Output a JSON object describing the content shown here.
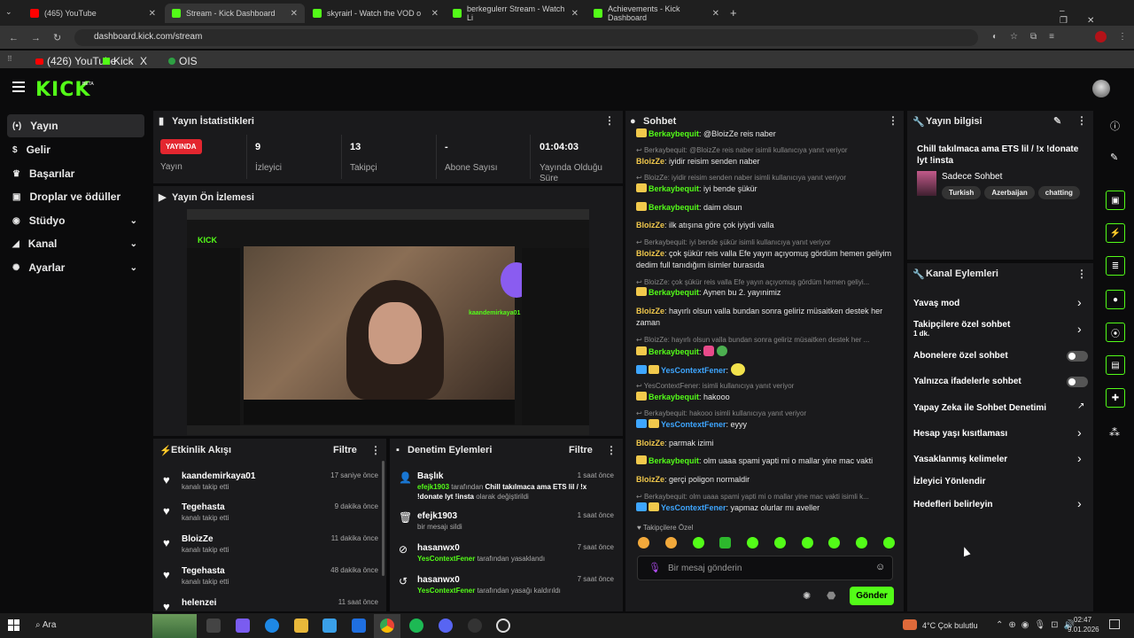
{
  "browser": {
    "tabs": [
      {
        "label": "(465) YouTube",
        "color": "#ff0000"
      },
      {
        "label": "Stream - Kick Dashboard",
        "color": "#53fc18"
      },
      {
        "label": "skyrairl - Watch the VOD o",
        "color": "#53fc18"
      },
      {
        "label": "berkegulerr Stream - Watch Li",
        "color": "#53fc18"
      },
      {
        "label": "Achievements - Kick Dashboard",
        "color": "#53fc18"
      }
    ],
    "url": "dashboard.kick.com/stream",
    "bookmarks": [
      "(426) YouTube",
      "Kick",
      "X",
      "OIS"
    ]
  },
  "brand": {
    "logo": "KICK",
    "beta": "BETA"
  },
  "sidebar": {
    "items": [
      {
        "label": "Yayın",
        "icon": "broadcast-icon"
      },
      {
        "label": "Gelir",
        "icon": "money-icon"
      },
      {
        "label": "Başarılar",
        "icon": "trophy-icon"
      },
      {
        "label": "Droplar ve ödüller",
        "icon": "gift-icon"
      },
      {
        "label": "Stüdyo",
        "icon": "studio-icon"
      },
      {
        "label": "Kanal",
        "icon": "channel-icon"
      },
      {
        "label": "Ayarlar",
        "icon": "gear-icon"
      }
    ]
  },
  "stats": {
    "title": "Yayın İstatistikleri",
    "live_badge": "YAYINDA",
    "items": [
      {
        "value": "",
        "label": "Yayın"
      },
      {
        "value": "9",
        "label": "İzleyici"
      },
      {
        "value": "13",
        "label": "Takipçi"
      },
      {
        "value": "-",
        "label": "Abone Sayısı"
      },
      {
        "value": "01:04:03",
        "label": "Yayında Olduğu Süre"
      }
    ]
  },
  "preview": {
    "title": "Yayın Ön İzlemesi",
    "overlay_text": "kaandemirkaya01 is now following!"
  },
  "activity": {
    "title": "Etkinlik Akışı",
    "filter": "Filtre",
    "items": [
      {
        "name": "kaandemirkaya01",
        "sub": "kanalı takip etti",
        "time": "17 saniye önce"
      },
      {
        "name": "Tegehasta",
        "sub": "kanalı takip etti",
        "time": "9 dakika önce"
      },
      {
        "name": "BloizZe",
        "sub": "kanalı takip etti",
        "time": "11 dakika önce"
      },
      {
        "name": "Tegehasta",
        "sub": "kanalı takip etti",
        "time": "48 dakika önce"
      },
      {
        "name": "helenzei",
        "sub": "",
        "time": "11 saat önce"
      }
    ]
  },
  "moderation": {
    "title": "Denetim Eylemleri",
    "filter": "Filtre",
    "items": [
      {
        "name": "Başlık",
        "actor": "efejk1903",
        "sub": " tarafından ",
        "detail": "Chill takılmaca ama ETS lil / !x !donate lyt !insta",
        "suffix": " olarak değiştirildi",
        "time": "1 saat önce",
        "icon": "edit-user-icon"
      },
      {
        "name": "efejk1903",
        "actor": "",
        "sub": "bir mesajı sildi",
        "detail": "",
        "suffix": "",
        "time": "1 saat önce",
        "icon": "trash-icon"
      },
      {
        "name": "hasanwx0",
        "actor": "YesContextFener",
        "sub": " tarafından yasaklandı",
        "detail": "",
        "suffix": "",
        "time": "7 saat önce",
        "icon": "ban-icon"
      },
      {
        "name": "hasanwx0",
        "actor": "YesContextFener",
        "sub": " tarafından yasağı kaldırıldı",
        "detail": "",
        "suffix": "",
        "time": "7 saat önce",
        "icon": "undo-icon"
      }
    ]
  },
  "chat": {
    "title": "Sohbet",
    "top_partial": {
      "user": "Berkaybequit",
      "text": "@BloizZe reis naber"
    },
    "messages": [
      {
        "reply": "Berkaybequit: @BloizZe reis naber isimli kullanıcıya yanıt veriyor",
        "user": "BloizZe",
        "ucolor": "ye",
        "text": "iyidir reisim senden naber",
        "badge": ""
      },
      {
        "reply": "BloizZe: iyidir reisim senden naber isimli kullanıcıya yanıt veriyor",
        "user": "Berkaybequit",
        "ucolor": "gr",
        "text": "iyi bende şükür",
        "badge": "crown"
      },
      {
        "reply": "",
        "user": "Berkaybequit",
        "ucolor": "gr",
        "text": "daim olsun",
        "badge": "crown"
      },
      {
        "reply": "",
        "user": "BloizZe",
        "ucolor": "ye",
        "text": "ilk atışına göre çok iyiydi valla",
        "badge": ""
      },
      {
        "reply": "Berkaybequit: iyi bende şükür isimli kullanıcıya yanıt veriyor",
        "user": "BloizZe",
        "ucolor": "ye",
        "text": "çok şükür reis valla Efe yayın açıyomuş gördüm hemen geliyim dedim full tanıdığım isimler burasıda",
        "badge": ""
      },
      {
        "reply": "BloizZe: çok şükür reis valla Efe yayın açıyomuş gördüm hemen geliyi...",
        "user": "Berkaybequit",
        "ucolor": "gr",
        "text": "Aynen bu 2. yayınimiz",
        "badge": "crown"
      },
      {
        "reply": "",
        "user": "BloizZe",
        "ucolor": "ye",
        "text": "hayırlı olsun valla bundan sonra geliriz müsaitken destek her zaman",
        "badge": ""
      },
      {
        "reply": "BloizZe: hayırlı olsun valla bundan sonra geliriz müsaitken destek her ...",
        "user": "Berkaybequit",
        "ucolor": "gr",
        "text": "",
        "badge": "crown"
      },
      {
        "reply": "",
        "user": "YesContextFener",
        "ucolor": "bl",
        "text": "",
        "badge": "both"
      },
      {
        "reply": "YesContextFener: isimli kullanıcıya yanıt veriyor",
        "user": "Berkaybequit",
        "ucolor": "gr",
        "text": "hakooo",
        "badge": "crown"
      },
      {
        "reply": "Berkaybequit: hakooo isimli kullanıcıya yanıt veriyor",
        "user": "YesContextFener",
        "ucolor": "bl",
        "text": "eyyy",
        "badge": "both"
      },
      {
        "reply": "",
        "user": "BloizZe",
        "ucolor": "ye",
        "text": "parmak izimi",
        "badge": ""
      },
      {
        "reply": "",
        "user": "Berkaybequit",
        "ucolor": "gr",
        "text": "olm uaaa spami yapti mi o mallar yine mac vakti",
        "badge": "crown"
      },
      {
        "reply": "",
        "user": "BloizZe",
        "ucolor": "ye",
        "text": "gerçi poligon normaldir",
        "badge": ""
      },
      {
        "reply": "Berkaybequit: olm uaaa spami yapti mi o mallar yine mac vakti isimli k...",
        "user": "YesContextFener",
        "ucolor": "bl",
        "text": "yapmaz olurlar mı aveller",
        "badge": "both"
      }
    ],
    "followers_only": "Takipçilere Özel",
    "input_placeholder": "Bir mesaj gönderin",
    "send": "Gönder"
  },
  "stream_info": {
    "title": "Yayın bilgisi",
    "stream_title": "Chill takılmaca ama ETS lil / !x !donate lyt !insta",
    "category": "Sadece Sohbet",
    "tags": [
      "Turkish",
      "Azerbaijan",
      "chatting"
    ]
  },
  "channel_actions": {
    "title": "Kanal Eylemleri",
    "items": [
      {
        "label": "Yavaş mod",
        "sub": "",
        "control": "arrow"
      },
      {
        "label": "Takipçilere özel sohbet",
        "sub": "1 dk.",
        "control": "arrow"
      },
      {
        "label": "Abonelere özel sohbet",
        "sub": "",
        "control": "toggle"
      },
      {
        "label": "Yalnızca ifadelerle sohbet",
        "sub": "",
        "control": "toggle"
      },
      {
        "label": "Yapay Zeka ile Sohbet Denetimi",
        "sub": "",
        "control": "external"
      },
      {
        "label": "Hesap yaşı kısıtlaması",
        "sub": "",
        "control": "arrow"
      },
      {
        "label": "Yasaklanmış kelimeler",
        "sub": "",
        "control": "arrow"
      },
      {
        "label": "İzleyici Yönlendir",
        "sub": "",
        "control": "none"
      },
      {
        "label": "Hedefleri belirleyin",
        "sub": "",
        "control": "arrow"
      }
    ]
  },
  "taskbar": {
    "search": "Ara",
    "weather": "4°C  Çok bulutlu",
    "time": "02:47",
    "date": "9.01.2026"
  }
}
